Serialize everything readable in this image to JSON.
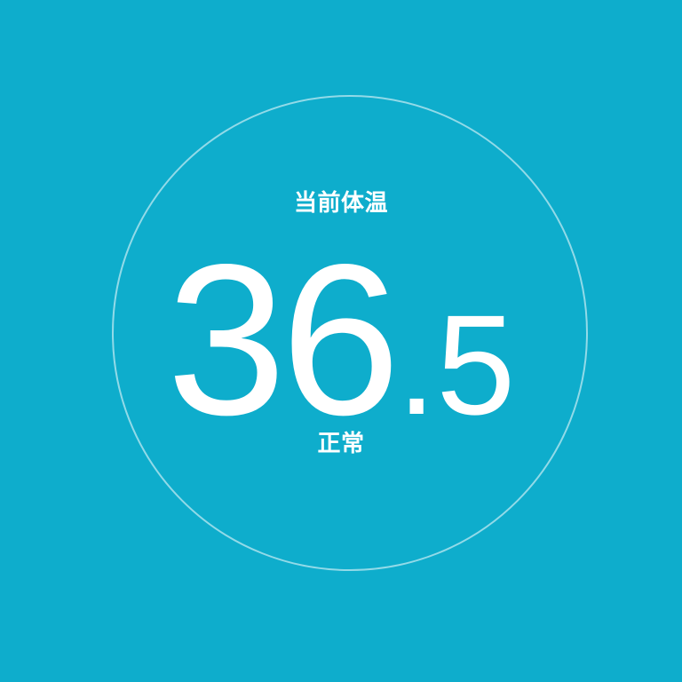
{
  "colors": {
    "background": "#0eadcc",
    "text": "#ffffff",
    "ring": "#ffffff"
  },
  "display": {
    "title": "当前体温",
    "value_whole": "36",
    "value_decimal_point": ".",
    "value_fraction": "5",
    "status": "正常"
  }
}
